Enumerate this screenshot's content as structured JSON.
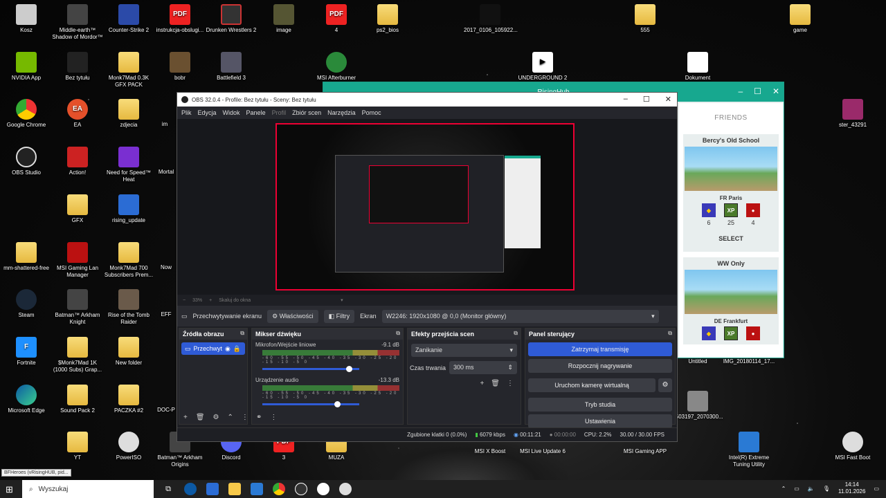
{
  "desktop": {
    "col1": [
      "Kosz",
      "NVIDIA App",
      "Google Chrome",
      "OBS Studio",
      "GFX",
      "mm-shattered-free",
      "Steam",
      "Fortnite",
      "Microsoft Edge",
      "YT"
    ],
    "col2": [
      "Middle-earth™ Shadow of Mordor™",
      "Bez tytułu",
      "EA",
      "Action!",
      "rising_update",
      "MSI Gaming Lan Manager",
      "Batman™ Arkham Knight",
      "$Monk7Mad 1K (1000 Subs) Grap...",
      "Sound Pack 2",
      "PowerISO"
    ],
    "col3": [
      "Counter-Strike 2",
      "Monk7Mad 0.3K GFX PACK",
      "zdjecia",
      "Need for Speed™ Heat",
      "Monk7Mad 700 Subscribers Prem...",
      "Rise of the Tomb Raider",
      "New folder",
      "PACZKA #2",
      "Batman™ Arkham Origins"
    ],
    "top_row": [
      "instrukcja-obslugi...",
      "Drunken Wrestlers 2",
      "image",
      "4",
      "ps2_bios",
      "2017_0106_105922...",
      "555",
      "game"
    ],
    "second_row": [
      "bobr",
      "Battlefield 3",
      "MSI Afterburner",
      "UNDERGROUND 2",
      "Dokument"
    ],
    "partial_left": [
      "im",
      "Mortal",
      "Now",
      "EFF",
      "DOC-P"
    ],
    "right_side": [
      "ster_43291",
      "Untitled",
      "IMG_20180114_17...",
      "1503197_2070300...",
      "Intel(R) Extreme Tuning Utility",
      "MSI Fast Boot",
      "MSI Gaming APP"
    ],
    "bottom_row": [
      "Discord",
      "3",
      "MUZA",
      "MSI X Boost",
      "MSI Live Update 6"
    ]
  },
  "risinghub": {
    "title": "RisingHub",
    "friends": "FRIENDS",
    "card1": {
      "name": "Bercy's Old School",
      "server": "FR Paris",
      "counts": [
        "6",
        "25",
        "4"
      ]
    },
    "select": "SELECT",
    "card2": {
      "name": "WW Only",
      "server": "DE Frankfurt"
    }
  },
  "obs": {
    "title": "OBS 32.0.4 - Profile: Bez tytułu - Sceny: Bez tytułu",
    "menu": [
      "Plik",
      "Edycja",
      "Widok",
      "Panele",
      "Profil",
      "Zbiór scen",
      "Narzędzia",
      "Pomoc"
    ],
    "zoom": "33%",
    "zoom_mode": "Skaluj do okna",
    "source_name": "Przechwytywanie ekranu",
    "properties": "Właściwości",
    "filters": "Filtry",
    "screen_label": "Ekran",
    "screen_value": "W2246: 1920x1080 @ 0,0 (Monitor główny)",
    "sources_title": "Źródła obrazu",
    "source_item": "Przechwyt",
    "mixer_title": "Mikser dźwięku",
    "mic_name": "Mikrofon/Wejście liniowe",
    "mic_db": "-9.1 dB",
    "desk_name": "Urządzenie audio",
    "desk_db": "-13.3 dB",
    "meter_ticks": "-60 -55 -50 -45 -40 -35 -30 -25 -20 -15 -10 -5 0",
    "mic_volume": 0.9,
    "desk_volume": 0.78,
    "trans_title": "Efekty przejścia scen",
    "transition": "Zanikanie",
    "duration_label": "Czas trwania",
    "duration": "300 ms",
    "controls_title": "Panel sterujący",
    "controls": [
      "Zatrzymaj transmisję",
      "Rozpocznij nagrywanie",
      "Uruchom kamerę wirtualną",
      "Tryb studia",
      "Ustawienia"
    ],
    "status": {
      "dropped": "Zgubione klatki 0 (0.0%)",
      "bitrate": "6079 kbps",
      "stream_time": "00:11:21",
      "rec_time": "00:00:00",
      "cpu": "CPU: 2.2%",
      "fps": "30.00 / 30.00 FPS"
    }
  },
  "taskbar": {
    "search": "Wyszukaj",
    "time": "14:14",
    "date": "11.01.2026"
  },
  "tooltip": "BFHeroes (vRisingHUB, pid..."
}
